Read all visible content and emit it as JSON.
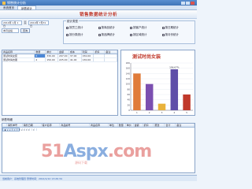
{
  "window": {
    "title": "销售统计分析",
    "tabs": [
      "系统首页",
      "销售统计"
    ]
  },
  "banner": {
    "title": "销售数据统计分析"
  },
  "filters": {
    "date_from": "2014年 1月 1日",
    "date_to": "2014年 7月31日",
    "select_value": "本月业绩",
    "button_label": "查询"
  },
  "options": {
    "title": "统计类型",
    "items": [
      "按员工统计",
      "按商品统计",
      "按客户统计",
      "按日期统计",
      "按分类统计",
      "按品牌统计",
      "按区域统计",
      "按月份统计"
    ]
  },
  "table1": {
    "headers": [
      "商品名称",
      "数量",
      "单价",
      "金额",
      "成本",
      "利润",
      "折扣",
      "备注"
    ],
    "rows": [
      [
        "测试时尚女装",
        "6",
        "330.00",
        "297.00",
        "37.00",
        "150.00",
        "",
        ""
      ],
      [
        "测试时尚衣服",
        "2",
        "150.00",
        "225.00",
        "41.00",
        "130.00",
        "",
        ""
      ]
    ]
  },
  "chart_data": {
    "type": "bar",
    "title": "测试时尚女装",
    "categories": [
      "1",
      "2",
      "3",
      "4",
      "5"
    ],
    "values": [
      140,
      100,
      25,
      156,
      60
    ],
    "data_labels": [
      "",
      "",
      "",
      "156.67%",
      ""
    ],
    "ylim": [
      0,
      180
    ],
    "y_ticks": [
      "180",
      "160",
      "140",
      "120",
      "100",
      "80",
      "60",
      "40",
      "20",
      "0"
    ],
    "grid": true,
    "bar_colors": [
      "#e07b39",
      "#7b4fb0",
      "#e9b23b",
      "#5f4fa8",
      "#c0392b"
    ]
  },
  "section2": {
    "title": "销售明细"
  },
  "table2": {
    "headers": [
      "",
      "销售单号",
      "销售日期",
      "客户名称",
      "商品编号",
      "商品名称",
      "单位",
      "数量",
      "单价",
      "金额",
      "折扣",
      "赠送",
      "合计",
      "备注"
    ],
    "rows": [
      [
        "▶",
        "2014072611",
        "2014/1/12 17:33",
        "测试时尚女装",
        "1403141730770551",
        "测试时尚女装",
        "件",
        "2",
        "1.00",
        "150",
        "0.00",
        "",
        "150.00",
        ""
      ]
    ]
  },
  "status": {
    "text": "当前用户：系统管理员  登录时间：2014/1/12 13:26:34"
  },
  "watermark": {
    "main_a": "51",
    "main_b": "Aspx",
    "main_c": ".com",
    "sub": "源码下载"
  }
}
